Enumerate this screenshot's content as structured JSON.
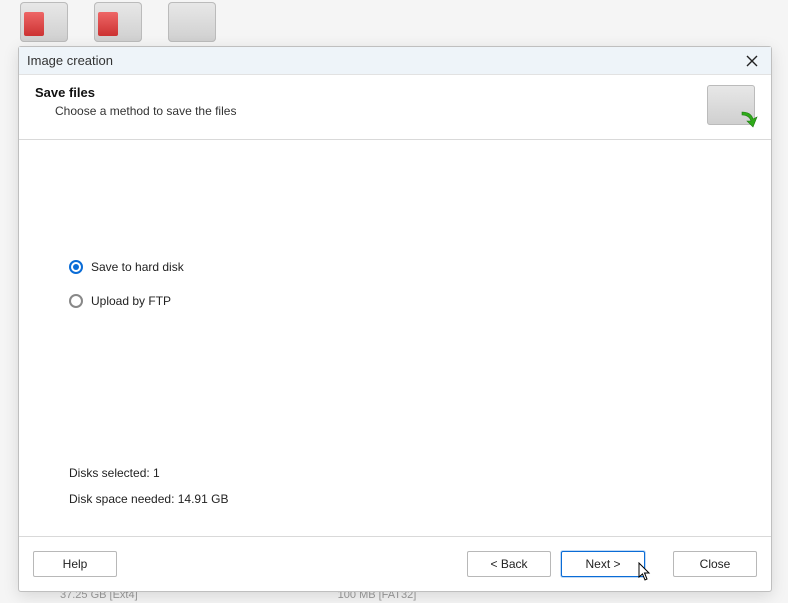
{
  "window": {
    "title": "Image creation"
  },
  "header": {
    "title": "Save files",
    "subtitle": "Choose a method to save the files"
  },
  "options": {
    "save_hd": {
      "label": "Save to hard disk",
      "checked": true
    },
    "upload_ftp": {
      "label": "Upload by FTP",
      "checked": false
    }
  },
  "info": {
    "disks_selected_label": "Disks selected:",
    "disks_selected_value": "1",
    "disk_space_label": "Disk space needed:",
    "disk_space_value": "14.91 GB"
  },
  "buttons": {
    "help": "Help",
    "back": "< Back",
    "next": "Next >",
    "close": "Close"
  },
  "background": {
    "status_left": "37.25 GB [Ext4]",
    "status_right": "100 MB [FAT32]"
  }
}
